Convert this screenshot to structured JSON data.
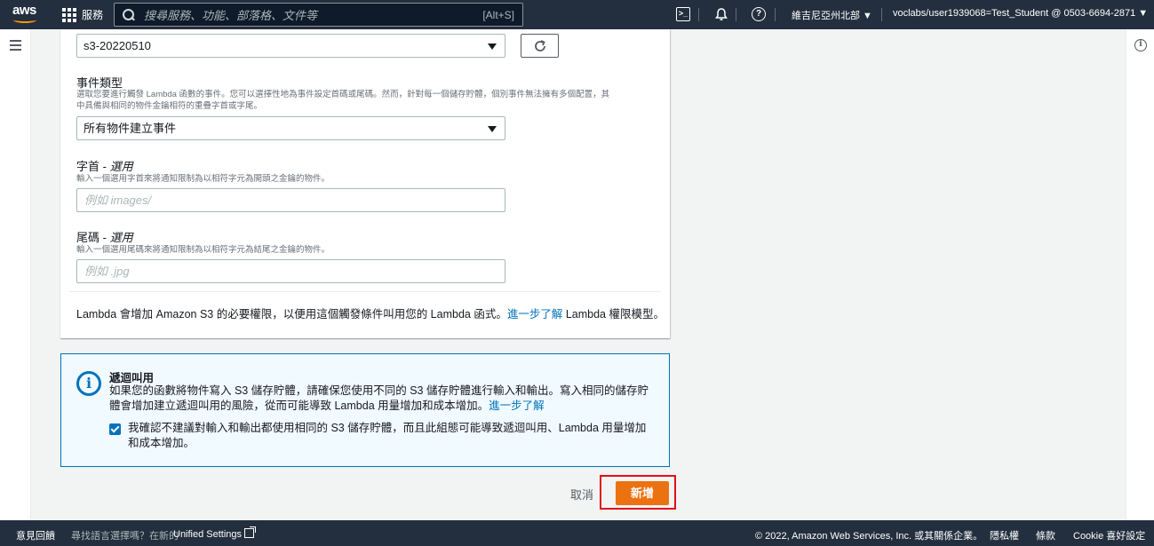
{
  "topnav": {
    "logo": "aws",
    "services_label": "服務",
    "search_placeholder": "搜尋服務、功能、部落格、文件等",
    "search_shortcut": "[Alt+S]",
    "cloudshell_icon": "cloudshell-icon",
    "notifications_icon": "bell-icon",
    "help_icon": "help-icon",
    "region": "維吉尼亞州北部 ▼",
    "account": "voclabs/user1939068=Test_Student @ 0503-6694-2871 ▼"
  },
  "form": {
    "bucket_value": "s3-20220510",
    "event_type": {
      "label": "事件類型",
      "description_line1": "選取您要進行觸發 Lambda 函數的事件。您可以選擇性地為事件設定首碼或尾碼。然而，針對每一個儲存貯體，個別事件無法擁有多個配置，其",
      "description_line2": "中具備與相同的物件金鑰相符的重疊字首或字尾。",
      "value": "所有物件建立事件"
    },
    "prefix": {
      "label": "字首 - ",
      "optional": "選用",
      "description": "輸入一個選用字首來將通知限制為以相符字元為開頭之金鑰的物件。",
      "placeholder": "例如 images/"
    },
    "suffix": {
      "label": "尾碼 - ",
      "optional": "選用",
      "description": "輸入一個選用尾碼來將通知限制為以相符字元為結尾之金鑰的物件。",
      "placeholder": "例如 .jpg"
    },
    "lambda_note_before": "Lambda 會增加 Amazon S3 的必要權限，以便用這個觸發條件叫用您的 Lambda 函式。",
    "lambda_note_link": "進一步了解",
    "lambda_note_after": " Lambda 權限模型。"
  },
  "alert": {
    "title": "遞迴叫用",
    "body": "如果您的函數將物件寫入 S3 儲存貯體，請確保您使用不同的 S3 儲存貯體進行輸入和輸出。寫入相同的儲存貯體會增加建立遞迴叫用的風險，從而可能導致 Lambda 用量增加和成本增加。",
    "link": "進一步了解",
    "checkbox_label": "我確認不建議對輸入和輸出都使用相同的 S3 儲存貯體，而且此組態可能導致遞迴叫用、Lambda 用量增加和成本增加。",
    "checkbox_checked": true
  },
  "actions": {
    "cancel": "取消",
    "add": "新增"
  },
  "footer": {
    "feedback": "意見回饋",
    "lang_prompt": "尋找語言選擇嗎？在新的",
    "unified_settings": "Unified Settings",
    "copyright": "© 2022, Amazon Web Services, Inc. 或其關係企業。",
    "privacy": "隱私權",
    "terms": "條款",
    "cookie": "Cookie 喜好設定"
  },
  "colors": {
    "nav_bg": "#232f3e",
    "accent": "#0073bb",
    "primary_button": "#ec7211",
    "highlight": "#e0101a"
  }
}
